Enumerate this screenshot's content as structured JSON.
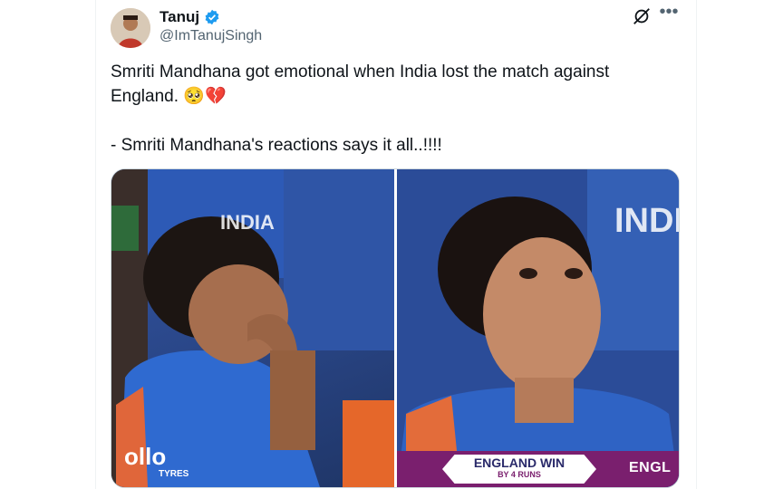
{
  "author": {
    "name": "Tanuj",
    "handle": "@ImTanujSingh",
    "verified_color": "#1d9bf0"
  },
  "tweet": {
    "text": "Smriti Mandhana got emotional when India lost the match against England. 🥺💔\n\n- Smriti Mandhana's reactions says it all..!!!!"
  },
  "actions": {
    "grok_icon": "grok-icon",
    "more_icon": "more-icon"
  },
  "media": {
    "left_photo": {
      "shirt_text": "ollo",
      "shirt_text2": "TYRES",
      "jersey_text": "INDIA"
    },
    "right_photo": {
      "jersey_text": "INDIA",
      "banner_main": "ENGLAND WIN",
      "banner_sub": "BY 4 RUNS",
      "banner_right": "ENGL"
    }
  },
  "colors": {
    "text": "#0f1419",
    "secondary": "#536471",
    "jersey_blue": "#2c4a8f",
    "banner_purple": "#7a1f6e"
  }
}
